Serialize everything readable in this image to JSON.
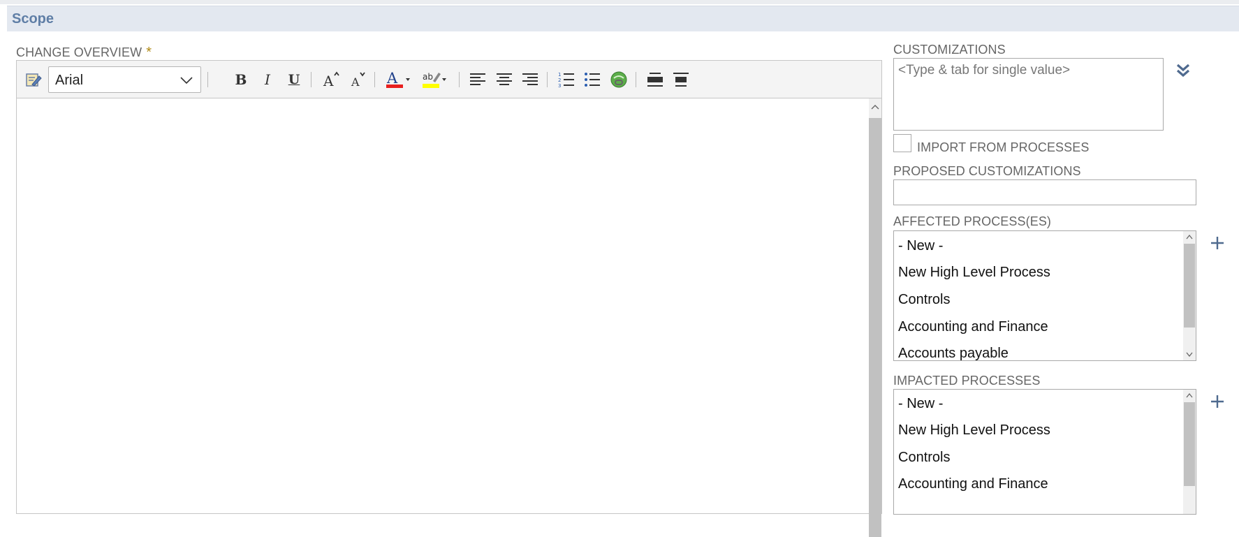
{
  "section": {
    "title": "Scope"
  },
  "change_overview": {
    "label": "CHANGE OVERVIEW",
    "required_mark": "*",
    "toolbar": {
      "font_value": "Arial",
      "bold": "B",
      "italic": "I",
      "underline": "U",
      "text_color": "#e8201f",
      "highlight_color": "#ffff00"
    }
  },
  "customizations": {
    "label": "CUSTOMIZATIONS",
    "placeholder": "<Type & tab for single value>"
  },
  "import_from_processes": {
    "label": "IMPORT FROM PROCESSES",
    "checked": false
  },
  "proposed_customizations": {
    "label": "PROPOSED CUSTOMIZATIONS",
    "value": ""
  },
  "affected_processes": {
    "label": "AFFECTED PROCESS(ES)",
    "items": [
      "- New -",
      "New High Level Process",
      "Controls",
      "Accounting and Finance",
      "Accounts payable"
    ]
  },
  "impacted_processes": {
    "label": "IMPACTED PROCESSES",
    "items": [
      "- New -",
      "New High Level Process",
      "Controls",
      "Accounting and Finance"
    ]
  },
  "colors": {
    "header_bg": "#e3e8f0",
    "header_text": "#5f7ea6",
    "accent_icon": "#4f6a8f"
  }
}
